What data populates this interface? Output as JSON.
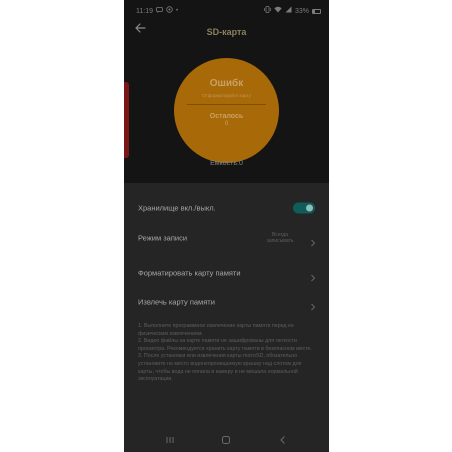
{
  "status_bar": {
    "time": "11:19",
    "left_icons": [
      "message-icon",
      "notification-icon"
    ],
    "battery_text": "33%",
    "battery_level": 0.33
  },
  "header": {
    "title": "SD-карта"
  },
  "storage": {
    "status": "Ошибк",
    "hint": "Отформатируйте карту",
    "remaining_label": "Осталось",
    "remaining_value": "0",
    "capacity": "Емкость:0"
  },
  "settings": {
    "storage_toggle_label": "Хранилище вкл./выкл.",
    "storage_toggle_on": true,
    "record_mode_label": "Режим записи",
    "record_mode_value": "Всегда записывать",
    "format_label": "Форматировать карту памяти",
    "eject_label": "Извлечь карту памяти"
  },
  "notes": [
    "1. Выполните программное извлечение карты памяти перед ее физическим извлечением.",
    "2. Видео файлы на карте памяти не зашифрованы для легкости просмотра. Рекомендуется хранить карту памяти в безопасном месте.",
    "3. После установки или извлечения карты microSD, обязательно установите на место водонепроницаемую крышку над слотом для карты, чтобы вода не попала в камеру и не мешала нормальной эксплуатации."
  ],
  "colors": {
    "circle": "#a86a08",
    "panel": "#252525",
    "background": "#141414",
    "toggle": "#0f5d58"
  }
}
